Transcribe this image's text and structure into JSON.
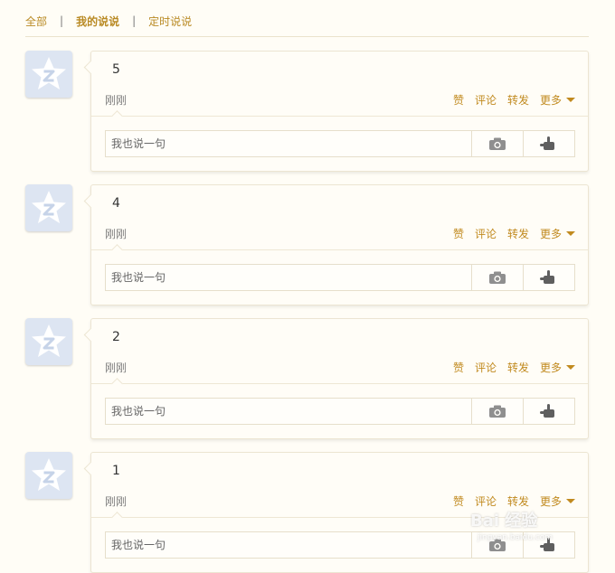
{
  "tabs": {
    "all": "全部",
    "separator": "|",
    "mine": "我的说说",
    "scheduled": "定时说说"
  },
  "posts": [
    {
      "content": "5",
      "time": "刚刚",
      "like": "赞",
      "comment": "评论",
      "forward": "转发",
      "more": "更多",
      "reply_placeholder": "我也说一句"
    },
    {
      "content": "4",
      "time": "刚刚",
      "like": "赞",
      "comment": "评论",
      "forward": "转发",
      "more": "更多",
      "reply_placeholder": "我也说一句"
    },
    {
      "content": "2",
      "time": "刚刚",
      "like": "赞",
      "comment": "评论",
      "forward": "转发",
      "more": "更多",
      "reply_placeholder": "我也说一句"
    },
    {
      "content": "1",
      "time": "刚刚",
      "like": "赞",
      "comment": "评论",
      "forward": "转发",
      "more": "更多",
      "reply_placeholder": "我也说一句"
    }
  ],
  "icons": {
    "avatar": "qzone-star-icon",
    "camera": "camera-icon",
    "hand": "hand-pointer-icon"
  },
  "colors": {
    "accent": "#c18a1f",
    "background": "#fffdf6",
    "avatar_bg": "#dde5f2"
  },
  "watermark": {
    "main": "Bai 经验",
    "sub": "jingyan.baidu.com"
  }
}
